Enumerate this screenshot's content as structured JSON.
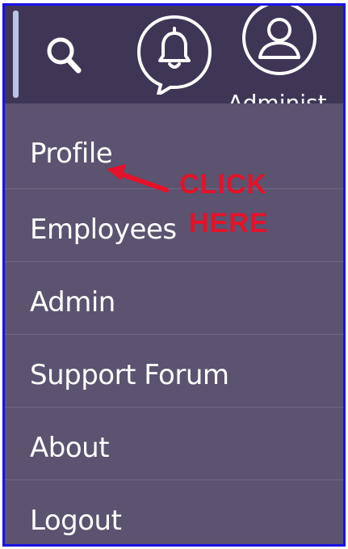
{
  "header": {
    "search_icon": "search-icon",
    "notification_icon": "bell-icon",
    "user_icon": "user-avatar-icon",
    "username": "Administ"
  },
  "menu": {
    "items": [
      {
        "label": "Profile"
      },
      {
        "label": "Employees"
      },
      {
        "label": "Admin"
      },
      {
        "label": "Support Forum"
      },
      {
        "label": "About"
      },
      {
        "label": "Logout"
      }
    ]
  },
  "annotation": {
    "line1": "CLICK",
    "line2": "HERE",
    "color": "#e4122a"
  },
  "colors": {
    "frame_border": "#1a12e6",
    "topbar_bg": "#3f3656",
    "menu_bg": "#5b536f",
    "divider": "#6e6784",
    "text": "#ffffff"
  }
}
